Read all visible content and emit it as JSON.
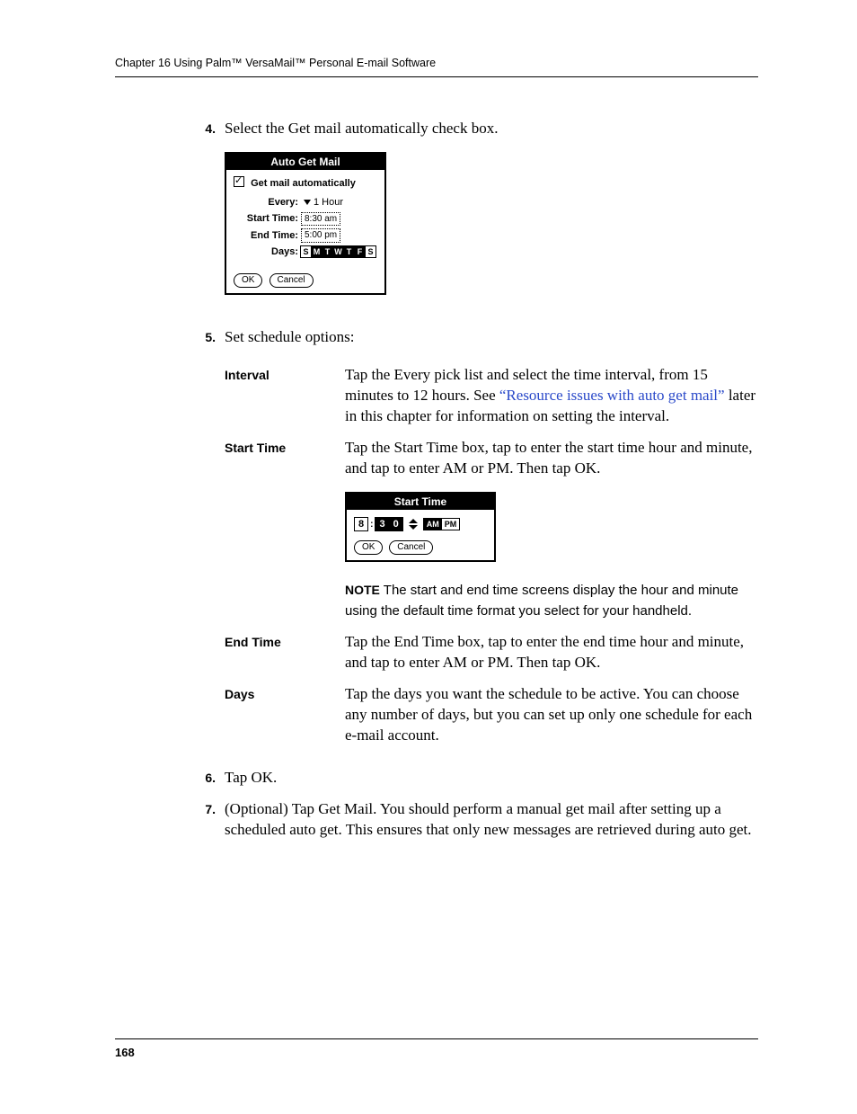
{
  "header_line": "Chapter 16   Using Palm™ VersaMail™ Personal E-mail Software",
  "step4_num": "4.",
  "step4_text": "Select the Get mail automatically check box.",
  "palm1": {
    "title": "Auto Get Mail",
    "checkbox_label": "Get mail automatically",
    "every_label": "Every:",
    "every_value": "1 Hour",
    "start_label": "Start Time:",
    "start_value": "8:30 am",
    "end_label": "End Time:",
    "end_value": "5:00 pm",
    "days_label": "Days:",
    "days": [
      "S",
      "M",
      "T",
      "W",
      "T",
      "F",
      "S"
    ],
    "ok": "OK",
    "cancel": "Cancel"
  },
  "step5_num": "5.",
  "step5_text": "Set schedule options:",
  "opts": {
    "interval_label": "Interval",
    "interval_text_a": "Tap the Every pick list and select the time interval, from 15 minutes to 12 hours. See ",
    "interval_link": "“Resource issues with auto get mail”",
    "interval_text_b": " later in this chapter for information on setting the interval.",
    "start_label": "Start Time",
    "start_text": "Tap the Start Time box, tap to enter the start time hour and minute, and tap to enter AM or PM. Then tap OK.",
    "note_label": "NOTE",
    "note_text": "  The start and end time screens display the hour and minute using the default time format you select for your handheld.",
    "end_label": "End Time",
    "end_text": "Tap the End Time box, tap to enter the end time hour and minute, and tap to enter AM or PM. Then tap OK.",
    "days_label": "Days",
    "days_text": "Tap the days you want the schedule to be active. You can choose any number of days, but you can set up only one schedule for each e-mail account."
  },
  "palm2": {
    "title": "Start Time",
    "hour": "8",
    "min_tens": "3",
    "min_ones": "0",
    "am": "AM",
    "pm": "PM",
    "ok": "OK",
    "cancel": "Cancel"
  },
  "step6_num": "6.",
  "step6_text": "Tap OK.",
  "step7_num": "7.",
  "step7_text": "(Optional) Tap Get Mail. You should perform a manual get mail after setting up a scheduled auto get. This ensures that only new messages are retrieved during auto get.",
  "page_number": "168"
}
